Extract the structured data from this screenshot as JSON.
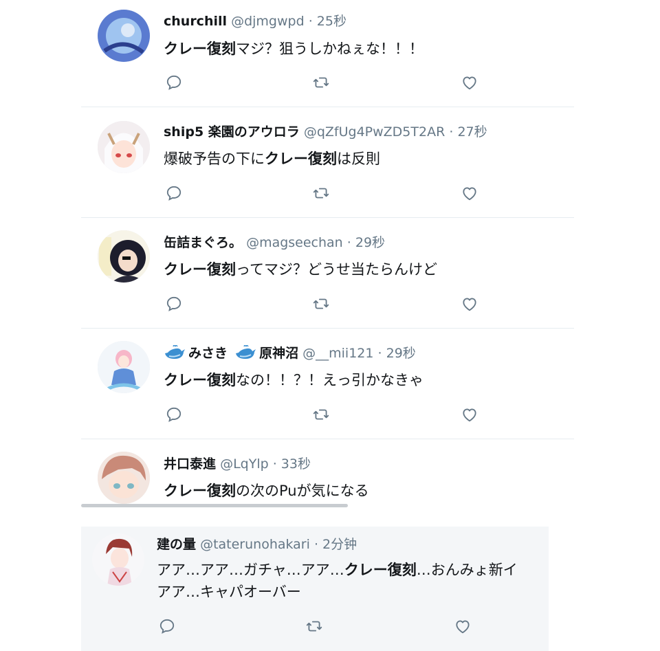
{
  "tweets": [
    {
      "name": "churchill",
      "handle": "@djmgwpd",
      "time": "25秒",
      "text_bold": "クレー復刻",
      "text_after": "マジ？狙うしかねぇな！！！"
    },
    {
      "name": "ship5 楽園のアウロラ",
      "handle": "@qZfUg4PwZD5T2AR",
      "time": "27秒",
      "text_before": "爆破予告の下に",
      "text_bold": "クレー復刻",
      "text_after": "は反則"
    },
    {
      "name": "缶詰まぐろ。",
      "handle": "@magseechan",
      "time": "29秒",
      "text_bold": "クレー復刻",
      "text_after": "ってマジ？どうせ当たらんけど"
    },
    {
      "name_part1": "みさき",
      "name_part2": "原神沼",
      "handle": "@__mii121",
      "time": "29秒",
      "text_bold": "クレー復刻",
      "text_after": "なの！！？！えっ引かなきゃ"
    },
    {
      "name": "井口泰進",
      "handle": "@LqYlp",
      "time": "33秒",
      "text_bold": "クレー復刻",
      "text_after": "の次のPuが気になる"
    },
    {
      "name": "建の量",
      "handle": "@taterunohakari",
      "time": "2分钟",
      "text_before": "アア…アア…ガチャ…アア…",
      "text_bold": "クレー復刻",
      "text_after": "…おんみょ新イ",
      "text_line2": "アア…キャパオーバー"
    }
  ],
  "separator": "·",
  "icons": {
    "reply": "reply-bubble-icon",
    "retweet": "retweet-arrows-icon",
    "like": "heart-outline-icon",
    "whale": "whale-emoji-icon"
  },
  "colors": {
    "text": "#14171a",
    "muted": "#657786",
    "icon": "#657786",
    "divider": "#e6ecf0",
    "whale": "#3b8fd1"
  }
}
